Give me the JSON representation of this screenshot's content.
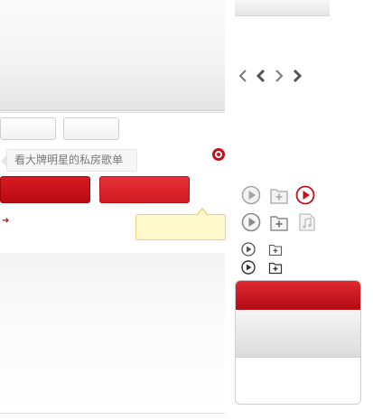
{
  "tooltip": {
    "text": "看大牌明星的私房歌单"
  },
  "colors": {
    "brand_red": "#c8101b",
    "note_yellow": "#fff9cc",
    "icon_gray": "#8a8a8a"
  },
  "icons": {
    "nav": [
      "chevron-left-icon",
      "chevron-left-bold-icon",
      "chevron-right-icon",
      "chevron-right-bold-icon"
    ],
    "row_large_1": [
      "play-icon",
      "add-folder-icon",
      "play-active-icon"
    ],
    "row_large_2": [
      "play-icon",
      "add-folder-icon",
      "music-file-icon"
    ],
    "row_small_1": [
      "play-small-icon",
      "add-folder-small-icon"
    ],
    "row_small_2": [
      "play-small-icon",
      "add-folder-small-icon"
    ]
  }
}
